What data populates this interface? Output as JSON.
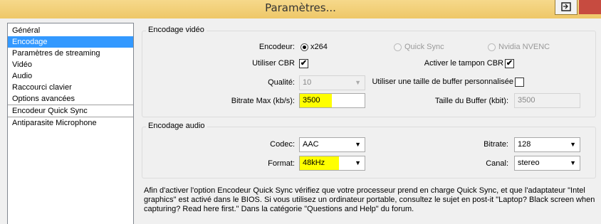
{
  "window": {
    "title": "Paramètres..."
  },
  "sidebar": {
    "items": [
      {
        "label": "Général"
      },
      {
        "label": "Encodage"
      },
      {
        "label": "Paramètres de streaming"
      },
      {
        "label": "Vidéo"
      },
      {
        "label": "Audio"
      },
      {
        "label": "Raccourci clavier"
      },
      {
        "label": "Options avancées"
      },
      {
        "label": "Encodeur Quick Sync"
      },
      {
        "label": "Antiparasite Microphone"
      }
    ],
    "selected": "Encodage"
  },
  "video": {
    "title": "Encodage vidéo",
    "encoder_label": "Encodeur:",
    "options": [
      "x264",
      "Quick Sync",
      "Nvidia NVENC"
    ],
    "selected_option": "x264",
    "cbr_label": "Utiliser CBR",
    "cbr_checked": true,
    "cbr_padding_label": "Activer le tampon CBR",
    "cbr_padding_checked": true,
    "quality_label": "Qualité:",
    "quality_value": "10",
    "custom_buffer_label": "Utiliser une taille de buffer personnalisée",
    "custom_buffer_checked": false,
    "bitrate_label": "Bitrate Max (kb/s):",
    "bitrate_value": "3500",
    "buffer_label": "Taille du Buffer (kbit):",
    "buffer_value": "3500",
    "highlight_color": "#ffff00"
  },
  "audio": {
    "title": "Encodage audio",
    "codec_label": "Codec:",
    "codec_value": "AAC",
    "format_label": "Format:",
    "format_value": "48kHz",
    "bitrate_label": "Bitrate:",
    "bitrate_value": "128",
    "channel_label": "Canal:",
    "channel_value": "stereo"
  },
  "info_text": "Afin d'activer l'option Encodeur Quick Sync vérifiez que votre processeur prend en charge Quick Sync, et que l'adaptateur \"Intel graphics\" est activé dans le BIOS. Si vous utilisez un ordinateur portable, consultez le sujet  en post-it \"Laptop? Black screen when capturing? Read here first.\" Dans la catégorie \"Questions and Help\" du forum.",
  "check_glyph": "✔",
  "arrow_glyph": "▼"
}
